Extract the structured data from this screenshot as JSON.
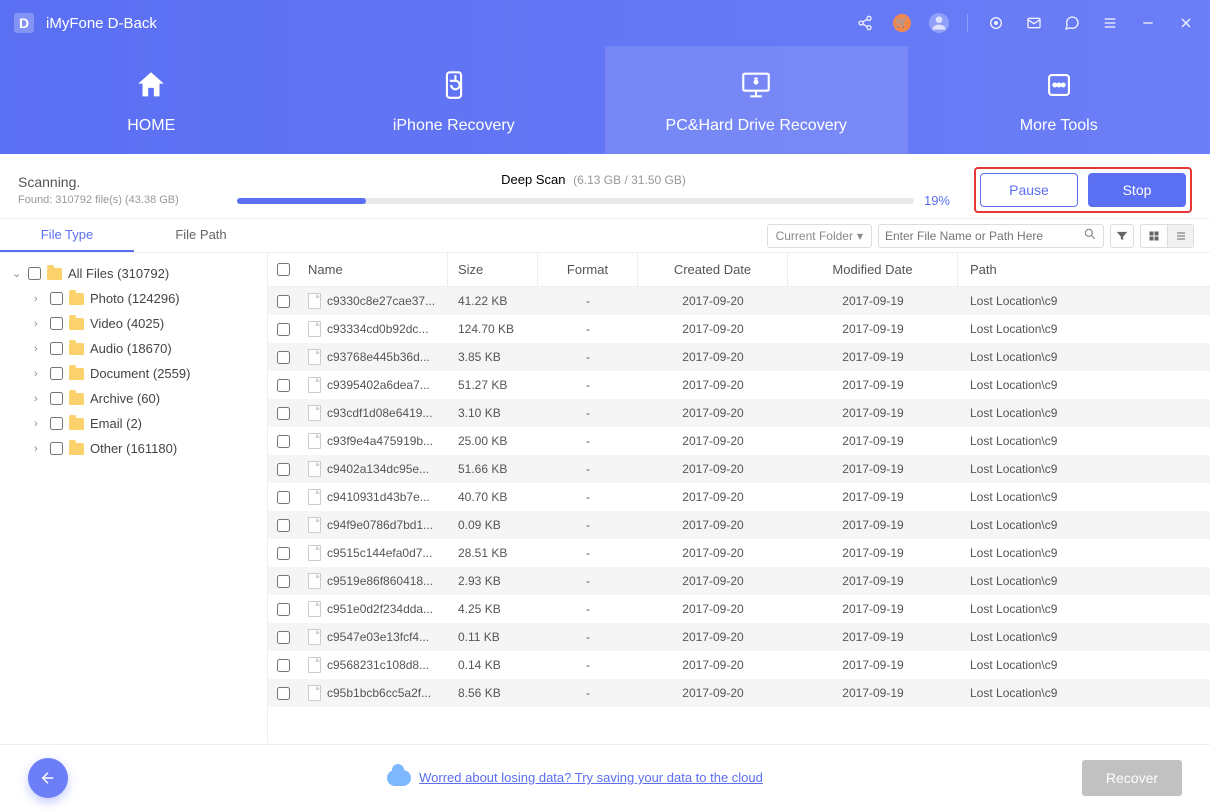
{
  "titlebar": {
    "logo": "D",
    "title": "iMyFone D-Back"
  },
  "nav": {
    "tabs": [
      {
        "label": "HOME"
      },
      {
        "label": "iPhone Recovery"
      },
      {
        "label": "PC&Hard Drive Recovery"
      },
      {
        "label": "More Tools"
      }
    ]
  },
  "scan": {
    "status_title": "Scanning.",
    "status_sub": "Found: 310792 file(s) (43.38 GB)",
    "deep_label": "Deep Scan",
    "gb_label": "(6.13 GB / 31.50 GB)",
    "pct": "19%",
    "pause": "Pause",
    "stop": "Stop"
  },
  "subbar": {
    "tabs": [
      "File Type",
      "File Path"
    ],
    "folder_dd": "Current Folder",
    "search_placeholder": "Enter File Name or Path Here"
  },
  "tree": {
    "root": "All Files (310792)",
    "children": [
      "Photo (124296)",
      "Video (4025)",
      "Audio (18670)",
      "Document (2559)",
      "Archive (60)",
      "Email (2)",
      "Other (161180)"
    ]
  },
  "table": {
    "headers": [
      "Name",
      "Size",
      "Format",
      "Created Date",
      "Modified Date",
      "Path"
    ],
    "rows": [
      {
        "name": "c9330c8e27cae37...",
        "size": "41.22 KB",
        "format": "-",
        "created": "2017-09-20",
        "modified": "2017-09-19",
        "path": "Lost Location\\c9"
      },
      {
        "name": "c93334cd0b92dc...",
        "size": "124.70 KB",
        "format": "-",
        "created": "2017-09-20",
        "modified": "2017-09-19",
        "path": "Lost Location\\c9"
      },
      {
        "name": "c93768e445b36d...",
        "size": "3.85 KB",
        "format": "-",
        "created": "2017-09-20",
        "modified": "2017-09-19",
        "path": "Lost Location\\c9"
      },
      {
        "name": "c9395402a6dea7...",
        "size": "51.27 KB",
        "format": "-",
        "created": "2017-09-20",
        "modified": "2017-09-19",
        "path": "Lost Location\\c9"
      },
      {
        "name": "c93cdf1d08e6419...",
        "size": "3.10 KB",
        "format": "-",
        "created": "2017-09-20",
        "modified": "2017-09-19",
        "path": "Lost Location\\c9"
      },
      {
        "name": "c93f9e4a475919b...",
        "size": "25.00 KB",
        "format": "-",
        "created": "2017-09-20",
        "modified": "2017-09-19",
        "path": "Lost Location\\c9"
      },
      {
        "name": "c9402a134dc95e...",
        "size": "51.66 KB",
        "format": "-",
        "created": "2017-09-20",
        "modified": "2017-09-19",
        "path": "Lost Location\\c9"
      },
      {
        "name": "c9410931d43b7e...",
        "size": "40.70 KB",
        "format": "-",
        "created": "2017-09-20",
        "modified": "2017-09-19",
        "path": "Lost Location\\c9"
      },
      {
        "name": "c94f9e0786d7bd1...",
        "size": "0.09 KB",
        "format": "-",
        "created": "2017-09-20",
        "modified": "2017-09-19",
        "path": "Lost Location\\c9"
      },
      {
        "name": "c9515c144efa0d7...",
        "size": "28.51 KB",
        "format": "-",
        "created": "2017-09-20",
        "modified": "2017-09-19",
        "path": "Lost Location\\c9"
      },
      {
        "name": "c9519e86f860418...",
        "size": "2.93 KB",
        "format": "-",
        "created": "2017-09-20",
        "modified": "2017-09-19",
        "path": "Lost Location\\c9"
      },
      {
        "name": "c951e0d2f234dda...",
        "size": "4.25 KB",
        "format": "-",
        "created": "2017-09-20",
        "modified": "2017-09-19",
        "path": "Lost Location\\c9"
      },
      {
        "name": "c9547e03e13fcf4...",
        "size": "0.11 KB",
        "format": "-",
        "created": "2017-09-20",
        "modified": "2017-09-19",
        "path": "Lost Location\\c9"
      },
      {
        "name": "c9568231c108d8...",
        "size": "0.14 KB",
        "format": "-",
        "created": "2017-09-20",
        "modified": "2017-09-19",
        "path": "Lost Location\\c9"
      },
      {
        "name": "c95b1bcb6cc5a2f...",
        "size": "8.56 KB",
        "format": "-",
        "created": "2017-09-20",
        "modified": "2017-09-19",
        "path": "Lost Location\\c9"
      }
    ]
  },
  "footer": {
    "cloud_msg": "Worred about losing data? Try saving your data to the cloud",
    "recover": "Recover"
  }
}
